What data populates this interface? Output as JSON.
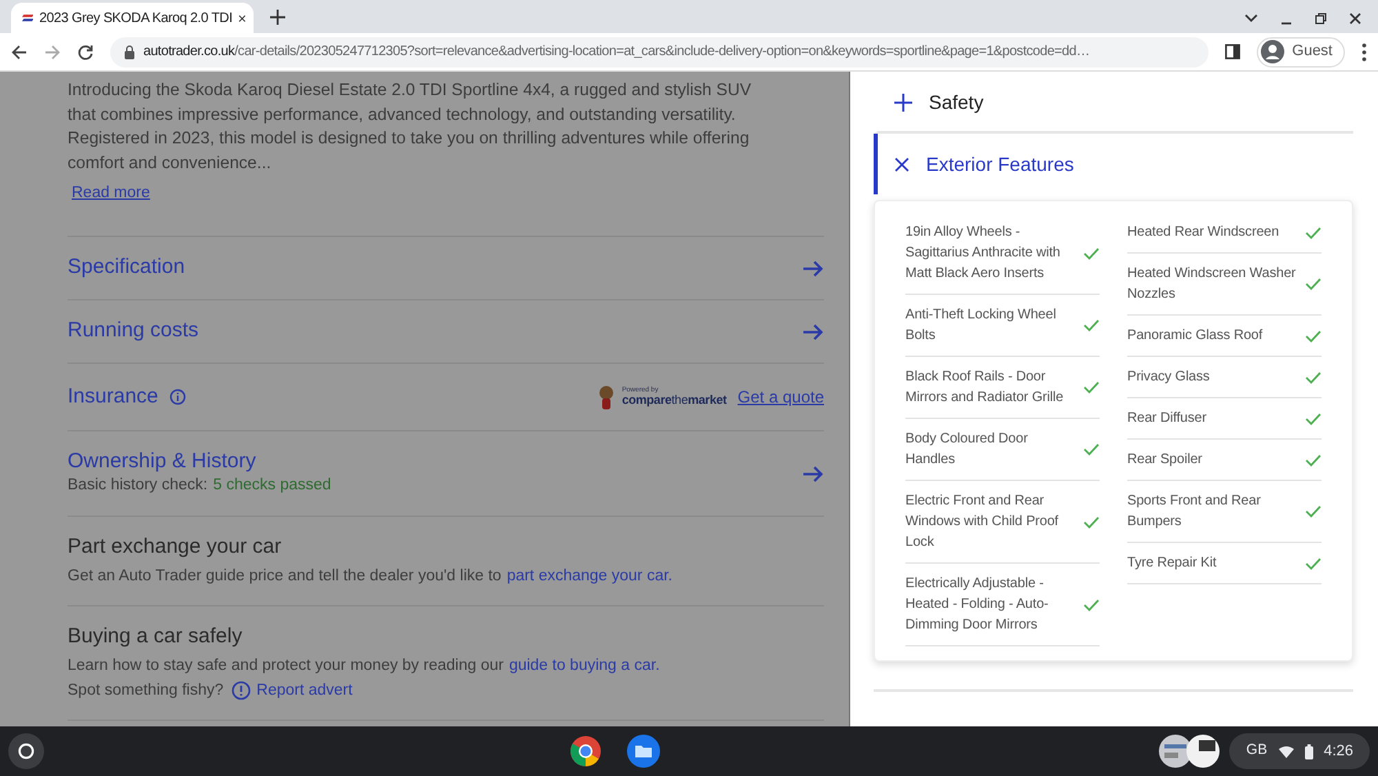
{
  "browser": {
    "tab_title": "2023 Grey SKODA Karoq 2.0 TDI",
    "url_domain": "autotrader.co.uk",
    "url_path": "/car-details/202305247712305?sort=relevance&advertising-location=at_cars&include-delivery-option=on&keywords=sportline&page=1&postcode=dd…",
    "profile": "Guest"
  },
  "description": {
    "text": "Introducing the Skoda Karoq Diesel Estate 2.0 TDI Sportline 4x4, a rugged and stylish SUV that combines impressive performance, advanced technology, and outstanding versatility. Registered in 2023, this model is designed to take you on thrilling adventures while offering comfort and convenience...",
    "link": "Read more"
  },
  "sections": [
    {
      "kind": "link",
      "title": "Specification"
    },
    {
      "kind": "link",
      "title": "Running costs"
    },
    {
      "kind": "insurance",
      "title": "Insurance",
      "powered_by": "Powered by",
      "partner": "**compare**the**market**",
      "link": "Get a quote"
    },
    {
      "kind": "history",
      "title": "Ownership & History",
      "label": "Basic history check:",
      "status": "5 checks passed"
    },
    {
      "kind": "info",
      "title": "Part exchange your car",
      "lines": [
        {
          "kind": "plain",
          "text": "Get an Auto Trader guide price and tell the dealer you'd like to",
          "link": "part exchange your car."
        }
      ]
    },
    {
      "kind": "info",
      "title": "Buying a car safely",
      "lines": [
        {
          "kind": "plain",
          "text": "Learn how to stay safe and protect your money by reading our",
          "link": "guide to buying a car."
        },
        {
          "kind": "report",
          "text": "Spot something fishy?",
          "link": "Report advert"
        }
      ]
    }
  ],
  "panel": {
    "groups": [
      {
        "title": "Safety",
        "expanded": false
      },
      {
        "title": "Exterior Features",
        "expanded": true,
        "columns": [
          [
            "19in Alloy Wheels - Sagittarius Anthracite with Matt Black Aero Inserts",
            "Anti-Theft Locking Wheel Bolts",
            "Black Roof Rails - Door Mirrors and Radiator Grille",
            "Body Coloured Door Handles",
            "Electric Front and Rear Windows with Child Proof Lock",
            "Electrically Adjustable - Heated - Folding - Auto-Dimming Door Mirrors"
          ],
          [
            "Heated Rear Windscreen",
            "Heated Windscreen Washer Nozzles",
            "Panoramic Glass Roof",
            "Privacy Glass",
            "Rear Diffuser",
            "Rear Spoiler",
            "Sports Front and Rear Bumpers",
            "Tyre Repair Kit"
          ]
        ]
      }
    ]
  },
  "shelf": {
    "keyboard": "GB",
    "time": "4:26"
  }
}
